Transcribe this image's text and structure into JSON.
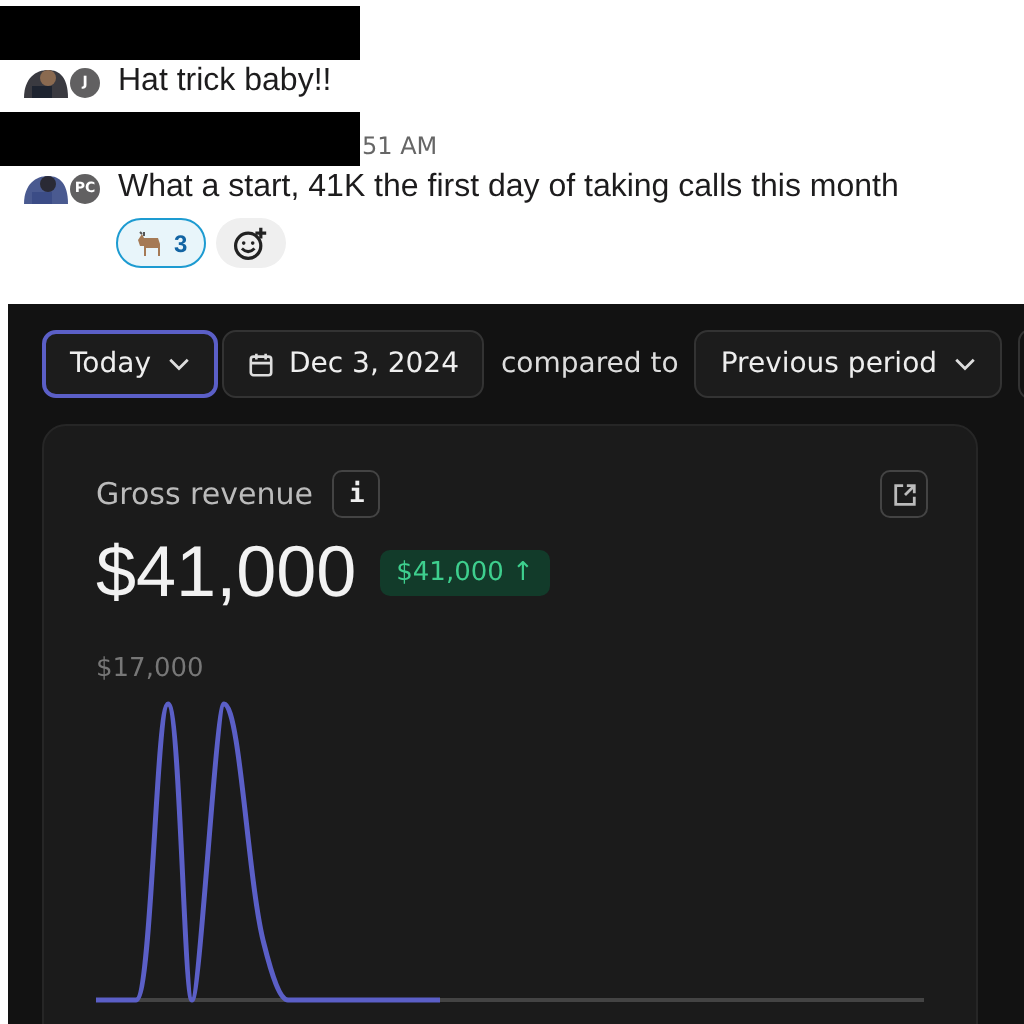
{
  "messages": [
    {
      "badge": "J",
      "text": "Hat trick baby!!"
    },
    {
      "badge": "PC",
      "text": "What a start, 41K the first day of taking calls this month",
      "time": "51 AM",
      "reactions": [
        {
          "count": "3",
          "selected": true
        }
      ]
    }
  ],
  "toolbar": {
    "range": {
      "label": "Today",
      "selected": true
    },
    "date": "Dec 3, 2024",
    "compare_label": "compared to",
    "compare": "Previous period"
  },
  "card": {
    "title": "Gross revenue",
    "info": "i",
    "value": "$41,000",
    "change": "$41,000 ↑",
    "chart_label": "$17,000"
  }
}
